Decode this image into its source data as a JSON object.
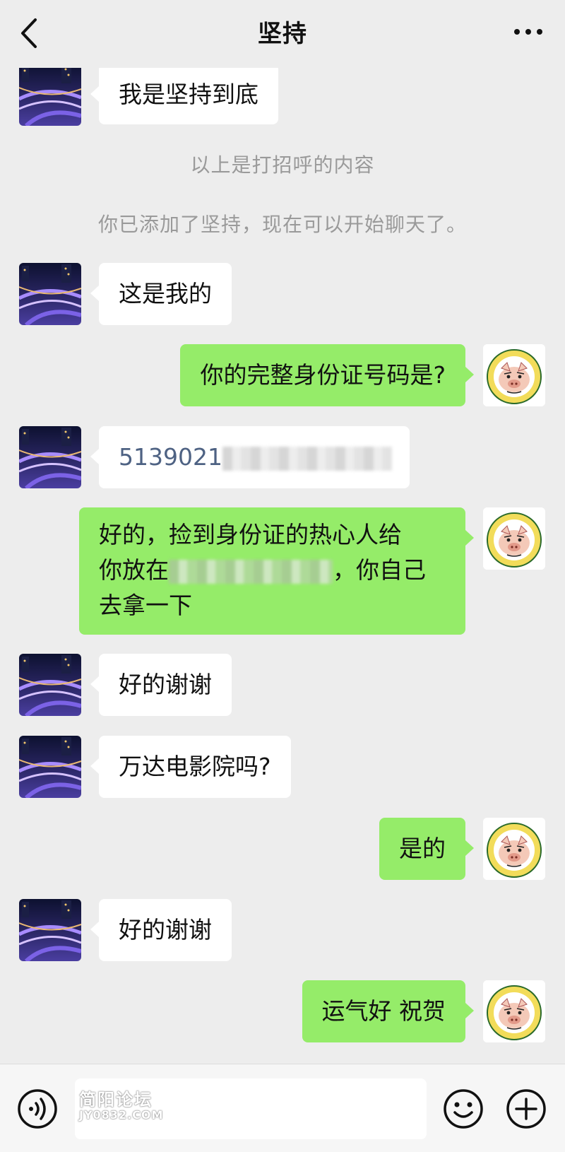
{
  "header": {
    "title": "坚持"
  },
  "messages": [
    {
      "side": "left",
      "text": "我是坚持到底"
    },
    {
      "system": "以上是打招呼的内容"
    },
    {
      "system": "你已添加了坚持，现在可以开始聊天了。"
    },
    {
      "side": "left",
      "text": "这是我的"
    },
    {
      "side": "right",
      "text": "你的完整身份证号码是?"
    },
    {
      "side": "left",
      "text": "5139021"
    },
    {
      "side": "right",
      "line1": "好的，捡到身份证的热心人给",
      "line2a": "你放在",
      "line2b": "，你自己",
      "line3": "去拿一下"
    },
    {
      "side": "left",
      "text": "好的谢谢"
    },
    {
      "side": "left",
      "text": "万达电影院吗?"
    },
    {
      "side": "right",
      "text": "是的"
    },
    {
      "side": "left",
      "text": "好的谢谢"
    },
    {
      "side": "right",
      "text": "运气好 祝贺"
    }
  ],
  "watermark": {
    "line1": "简阳论坛",
    "line2": "JY0832.COM"
  },
  "colors": {
    "background": "#ededed",
    "outgoing_bubble": "#95ec69",
    "incoming_bubble": "#ffffff"
  },
  "icons": {
    "back": "chevron-left-icon",
    "more": "more-dots-icon",
    "voice": "voice-icon",
    "emoji": "emoji-icon",
    "plus": "plus-circle-icon"
  }
}
